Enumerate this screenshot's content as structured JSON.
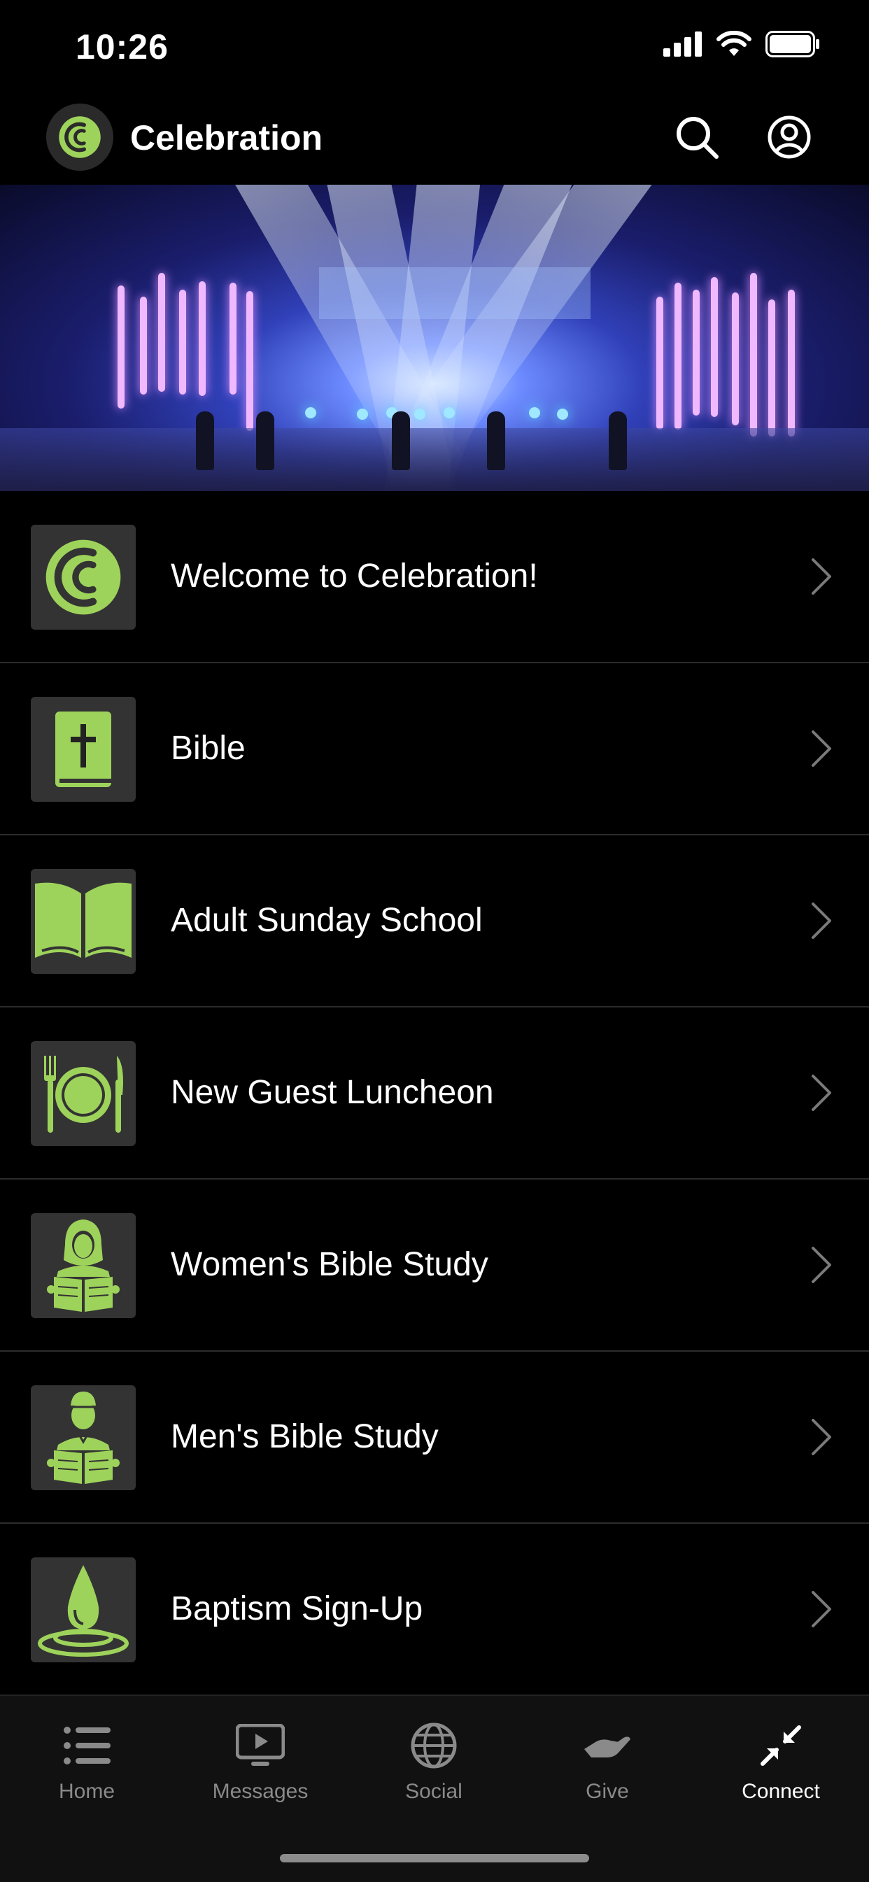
{
  "status": {
    "time": "10:26"
  },
  "header": {
    "title": "Celebration"
  },
  "menu": [
    {
      "label": "Welcome to Celebration!",
      "icon": "celebration-logo-icon"
    },
    {
      "label": "Bible",
      "icon": "bible-icon"
    },
    {
      "label": "Adult Sunday School",
      "icon": "open-book-icon"
    },
    {
      "label": "New Guest Luncheon",
      "icon": "plate-fork-knife-icon"
    },
    {
      "label": "Women's Bible Study",
      "icon": "woman-reading-icon"
    },
    {
      "label": "Men's Bible Study",
      "icon": "man-reading-icon"
    },
    {
      "label": "Baptism Sign-Up",
      "icon": "water-drop-icon"
    }
  ],
  "tabs": [
    {
      "label": "Home",
      "icon": "list-icon"
    },
    {
      "label": "Messages",
      "icon": "tv-play-icon"
    },
    {
      "label": "Social",
      "icon": "globe-icon"
    },
    {
      "label": "Give",
      "icon": "hand-icon"
    },
    {
      "label": "Connect",
      "icon": "arrows-inward-icon",
      "active": true
    }
  ],
  "colors": {
    "accent": "#9ed35b",
    "background": "#000000",
    "tile": "#333333",
    "tab_inactive": "#8a8a8a"
  }
}
